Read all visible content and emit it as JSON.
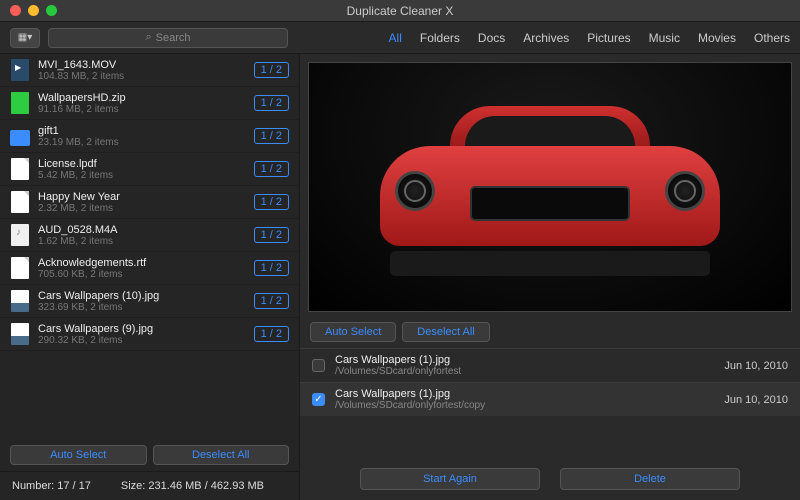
{
  "title": "Duplicate Cleaner X",
  "search_placeholder": "Search",
  "tabs": [
    "All",
    "Folders",
    "Docs",
    "Archives",
    "Pictures",
    "Music",
    "Movies",
    "Others"
  ],
  "active_tab": 0,
  "items": [
    {
      "icon": "mov",
      "name": "MVI_1643.MOV",
      "meta": "104.83 MB, 2 items",
      "badge": "1 / 2"
    },
    {
      "icon": "zip",
      "name": "WallpapersHD.zip",
      "meta": "91.16 MB, 2 items",
      "badge": "1 / 2"
    },
    {
      "icon": "folder",
      "name": "gift1",
      "meta": "23.19 MB, 2 items",
      "badge": "1 / 2"
    },
    {
      "icon": "doc",
      "name": "License.lpdf",
      "meta": "5.42 MB, 2 items",
      "badge": "1 / 2"
    },
    {
      "icon": "doc",
      "name": "Happy New Year",
      "meta": "2.32 MB, 2 items",
      "badge": "1 / 2"
    },
    {
      "icon": "audio",
      "name": "AUD_0528.M4A",
      "meta": "1.62 MB, 2 items",
      "badge": "1 / 2"
    },
    {
      "icon": "doc",
      "name": "Acknowledgements.rtf",
      "meta": "705.60 KB, 2 items",
      "badge": "1 / 2"
    },
    {
      "icon": "img",
      "name": "Cars Wallpapers (10).jpg",
      "meta": "323.69 KB, 2 items",
      "badge": "1 / 2"
    },
    {
      "icon": "img",
      "name": "Cars Wallpapers (9).jpg",
      "meta": "290.32 KB, 2 items",
      "badge": "1 / 2"
    }
  ],
  "side_btn1": "Auto Select",
  "side_btn2": "Deselect All",
  "status_number_label": "Number:",
  "status_number": "17 / 17",
  "status_size_label": "Size:",
  "status_size": "231.46 MB / 462.93 MB",
  "main_btn1": "Auto Select",
  "main_btn2": "Deselect All",
  "dups": [
    {
      "checked": false,
      "name": "Cars Wallpapers (1).jpg",
      "path": "/Volumes/SDcard/onlyfortest",
      "date": "Jun 10, 2010"
    },
    {
      "checked": true,
      "name": "Cars Wallpapers (1).jpg",
      "path": "/Volumes/SDcard/onlyfortest/copy",
      "date": "Jun 10, 2010"
    }
  ],
  "bottom_btn1": "Start Again",
  "bottom_btn2": "Delete"
}
